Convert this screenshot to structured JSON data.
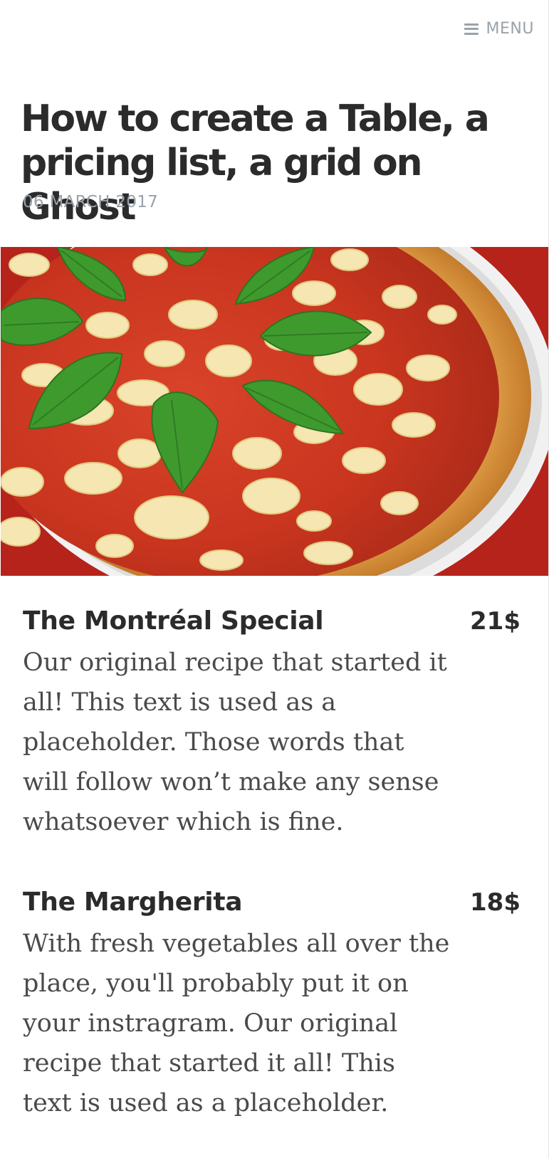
{
  "header": {
    "menu_label": "MENU",
    "menu_icon": "hamburger-icon"
  },
  "post": {
    "title": "How to create a Table, a pricing list, a grid on Ghost",
    "date": "06 MARCH 2017"
  },
  "hero": {
    "subject": "pizza"
  },
  "items": [
    {
      "name": "The Montréal Special",
      "price": "21$",
      "description": "Our original recipe that started it all! This text is used as a placeholder. Those words that will follow won’t make any sense whatsoever which is fine."
    },
    {
      "name": "The Margherita",
      "price": "18$",
      "description": "With fresh vegetables all over the place, you'll probably put it on your instragram. Our original recipe that started it all! This text is used as a placeholder."
    }
  ],
  "colors": {
    "text": "#2b2b2b",
    "muted": "#9aa3ab",
    "body": "#4a4a4a"
  }
}
